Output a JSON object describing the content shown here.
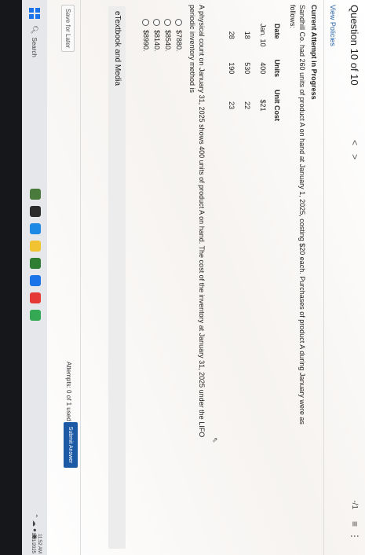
{
  "header": {
    "question_title": "Question 10 of 10",
    "prev_icon": "<",
    "next_icon": ">",
    "score": "-/1",
    "list_icon": "≡",
    "more_icon": "⋮"
  },
  "view_policies": "View Policies",
  "attempt_status": "Current Attempt in Progress",
  "question_text": "Sandhill Co. had 260 units of product A on hand at January 1, 2025, costing $20 each. Purchases of product A during January were as follows:",
  "table": {
    "headers": [
      "Date",
      "Units",
      "Unit Cost"
    ],
    "rows": [
      [
        "Jan. 10",
        "400",
        "$21"
      ],
      [
        "18",
        "530",
        "22"
      ],
      [
        "28",
        "190",
        "23"
      ]
    ]
  },
  "question_text_2": "A physical count on January 31, 2025 shows 400 units of product A on hand. The cost of the inventory at January 31, 2025 under the LIFO periodic inventory method is",
  "options": [
    "$7880.",
    "$8540.",
    "$8140.",
    "$8990."
  ],
  "ebook_label": "eTextbook and Media",
  "footer": {
    "save_label": "Save for Later",
    "attempts_text": "Attempts: 0 of 1 used",
    "submit_label": "Submit Answer"
  },
  "taskbar": {
    "search_label": "Search",
    "clock_time": "11:52 AM",
    "clock_date": "1/31/2025"
  },
  "colors": {
    "accent": "#1c5aa6",
    "link": "#2563a8"
  }
}
